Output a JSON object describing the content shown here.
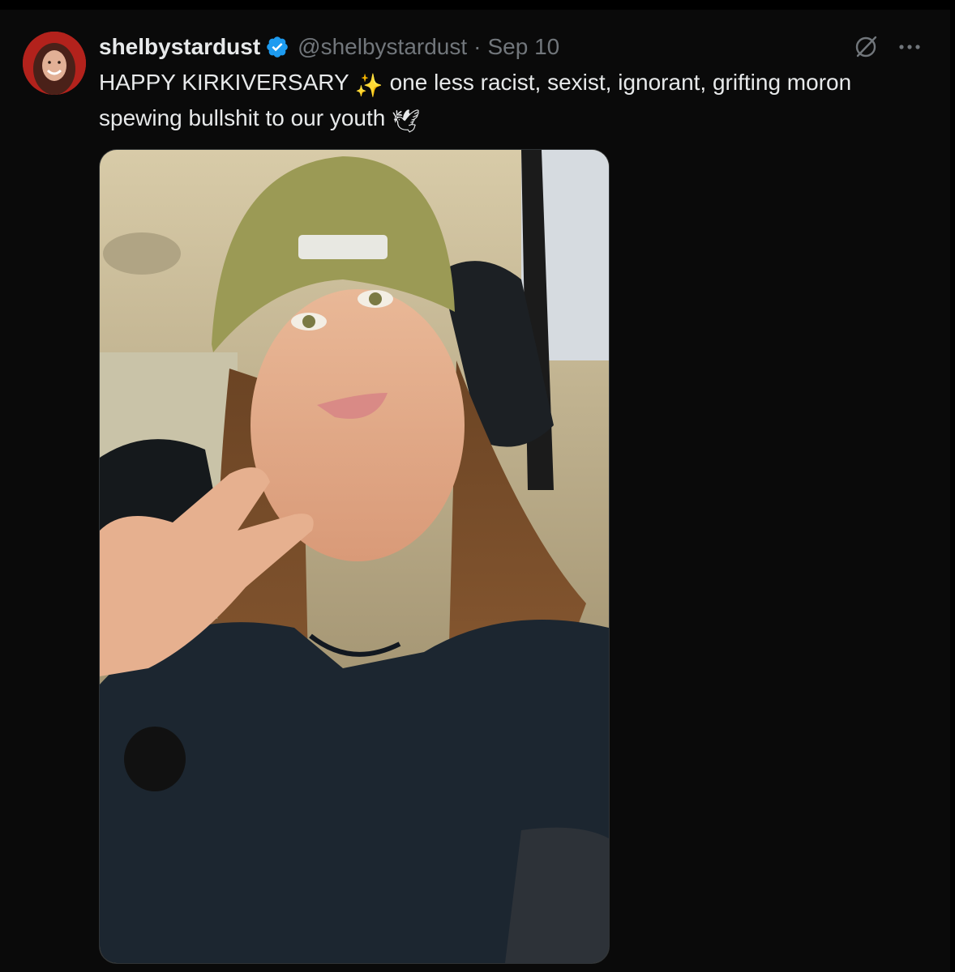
{
  "tweet": {
    "display_name": "shelbystardust",
    "verified_icon": "verified-badge-icon",
    "handle": "@shelbystardust",
    "separator": "·",
    "date": "Sep 10",
    "text_part1": "HAPPY KIRKIVERSARY ",
    "emoji_sparkles": "✨",
    "text_part2": " one less racist, sexist, ignorant, grifting moron spewing bullshit to our youth ",
    "emoji_dove": "🕊",
    "grok_icon": "grok-icon",
    "more_icon": "more-icon"
  },
  "colors": {
    "background": "#0a0a0a",
    "text_primary": "#e7e9ea",
    "text_secondary": "#71767b",
    "verified_blue": "#1d9bf0"
  }
}
